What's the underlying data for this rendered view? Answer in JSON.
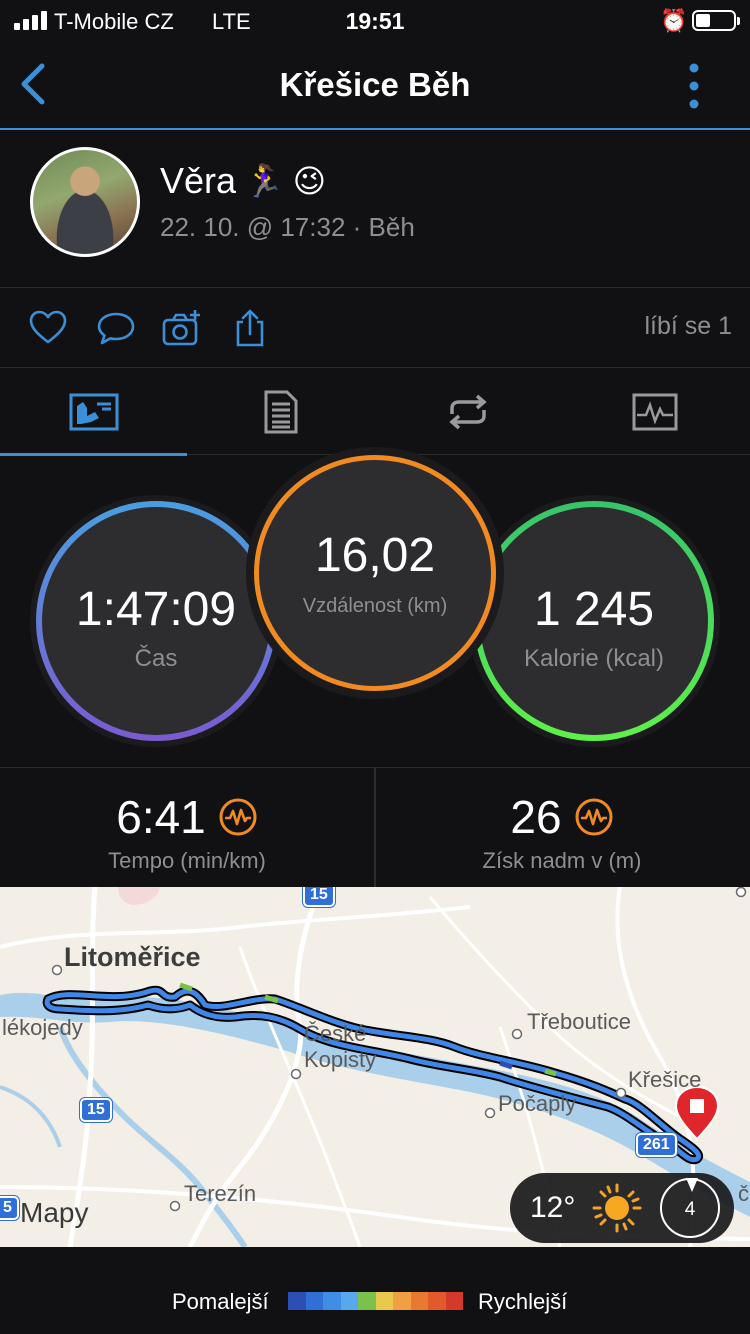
{
  "status_bar": {
    "carrier": "T-Mobile CZ",
    "network": "LTE",
    "time": "19:51"
  },
  "nav": {
    "title": "Křešice Běh"
  },
  "profile": {
    "name": "Věra",
    "emoji": "🏃‍♀️ 😉",
    "meta": "22. 10. @ 17:32 · Běh"
  },
  "actions": {
    "likes_text": "líbí se 1"
  },
  "tabs": [
    {
      "name": "summary-tab",
      "icon": "chart-card-icon",
      "active": true
    },
    {
      "name": "details-tab",
      "icon": "document-list-icon",
      "active": false
    },
    {
      "name": "laps-tab",
      "icon": "repeat-icon",
      "active": false
    },
    {
      "name": "graph-tab",
      "icon": "activity-graph-icon",
      "active": false
    }
  ],
  "stats": {
    "time": {
      "value": "1:47:09",
      "label": "Čas"
    },
    "distance": {
      "value": "16,02",
      "label": "Vzdálenost (km)"
    },
    "calories": {
      "value": "1 245",
      "label": "Kalorie (kcal)"
    }
  },
  "metrics": {
    "pace": {
      "value": "6:41",
      "label": "Tempo (min/km)"
    },
    "elevation": {
      "value": "26",
      "label": "Získ nadm v (m)"
    }
  },
  "map": {
    "labels": {
      "litomerice": "Litoměřice",
      "mlekojedy": "lékojedy",
      "ceske": "České",
      "kopisty": "Kopisty",
      "treboutice": "Třeboutice",
      "kresice": "Křešice",
      "pocaply": "Počaply",
      "terezin": "Terezín",
      "krc": "č"
    },
    "road_shields": {
      "top": "15",
      "left": "15",
      "edge": "5",
      "right": "261"
    },
    "brand": "Mapy",
    "weather": {
      "temperature": "12°",
      "wind": "4"
    }
  },
  "legend": {
    "slower": "Pomalejší",
    "faster": "Rychlejší",
    "colors": [
      "#2b4fb3",
      "#2f6fd6",
      "#3e8ee6",
      "#58a8ee",
      "#7bc24a",
      "#e8c94a",
      "#f0a040",
      "#e87a30",
      "#e35a2a",
      "#d33a2a"
    ]
  }
}
